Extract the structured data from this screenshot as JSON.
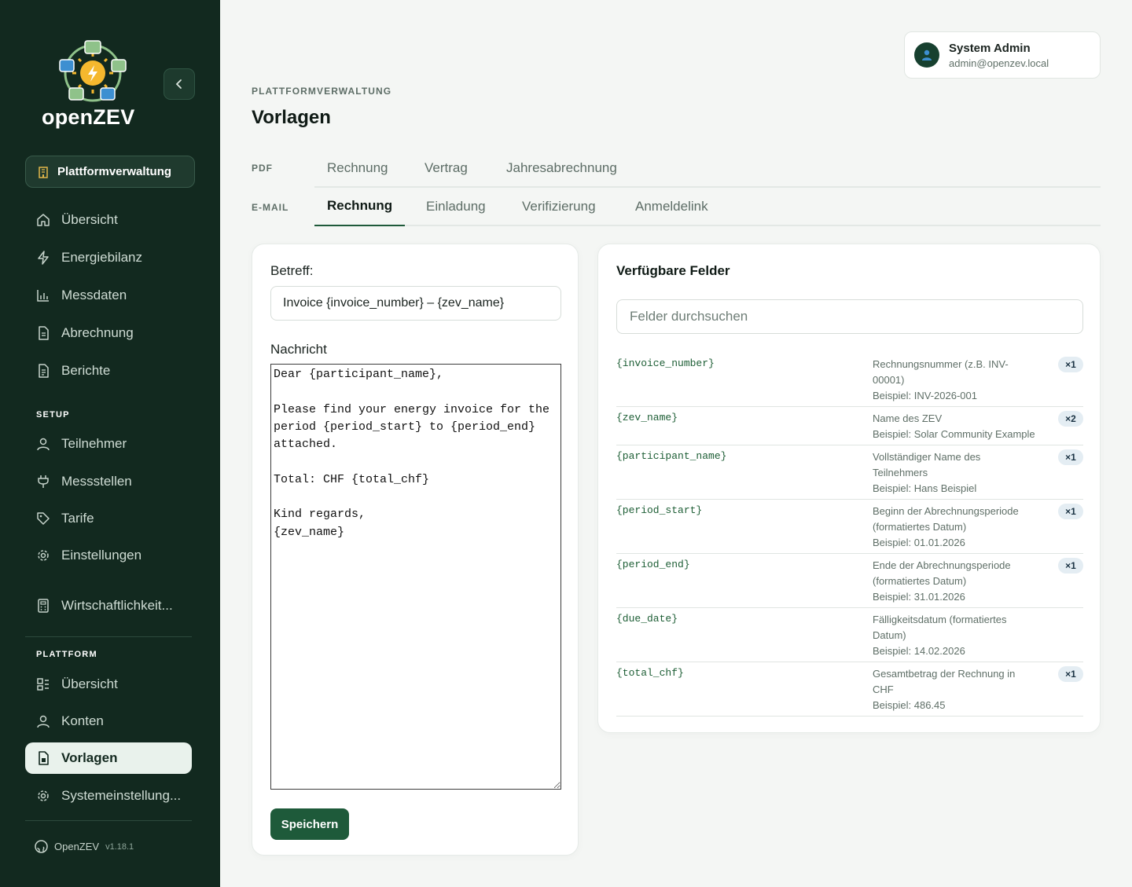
{
  "sidebar": {
    "logo_text": "openZEV",
    "platform_pill": "Plattformverwaltung",
    "main_items": [
      {
        "label": "Übersicht",
        "icon": "home-icon"
      },
      {
        "label": "Energiebilanz",
        "icon": "lightning-icon"
      },
      {
        "label": "Messdaten",
        "icon": "bar-chart-icon"
      },
      {
        "label": "Abrechnung",
        "icon": "document-icon"
      },
      {
        "label": "Berichte",
        "icon": "report-icon"
      }
    ],
    "setup_label": "SETUP",
    "setup_items": [
      {
        "label": "Teilnehmer",
        "icon": "user-icon"
      },
      {
        "label": "Messstellen",
        "icon": "plug-icon"
      },
      {
        "label": "Tarife",
        "icon": "tag-icon"
      },
      {
        "label": "Einstellungen",
        "icon": "gear-icon"
      },
      {
        "label": "Wirtschaftlichkeit...",
        "icon": "calculator-icon"
      }
    ],
    "platform_label": "PLATTFORM",
    "platform_items": [
      {
        "label": "Übersicht",
        "icon": "dashboard-icon"
      },
      {
        "label": "Konten",
        "icon": "users-icon"
      },
      {
        "label": "Vorlagen",
        "icon": "template-icon",
        "active": true
      },
      {
        "label": "Systemeinstellung...",
        "icon": "gear-icon"
      }
    ],
    "footer_name": "OpenZEV",
    "footer_version": "v1.18.1"
  },
  "user": {
    "name": "System Admin",
    "email": "admin@openzev.local"
  },
  "header": {
    "eyebrow": "PLATTFORMVERWALTUNG",
    "title": "Vorlagen"
  },
  "tabs": {
    "pdf_label": "PDF",
    "pdf_tabs": [
      "Rechnung",
      "Vertrag",
      "Jahresabrechnung"
    ],
    "email_label": "E-MAIL",
    "email_tabs": [
      "Rechnung",
      "Einladung",
      "Verifizierung",
      "Anmeldelink"
    ],
    "active_email_tab": "Rechnung"
  },
  "editor": {
    "subject_label": "Betreff:",
    "subject_value": "Invoice {invoice_number} – {zev_name}",
    "message_label": "Nachricht",
    "message_value": "Dear {participant_name},\n\nPlease find your energy invoice for the period {period_start} to {period_end} attached.\n\nTotal: CHF {total_chf}\n\nKind regards,\n{zev_name}",
    "save_label": "Speichern"
  },
  "fields_panel": {
    "title": "Verfügbare Felder",
    "search_placeholder": "Felder durchsuchen",
    "fields": [
      {
        "code": "{invoice_number}",
        "desc": "Rechnungsnummer (z.B. INV-00001)",
        "example": "Beispiel: INV-2026-001",
        "count": "×1"
      },
      {
        "code": "{zev_name}",
        "desc": "Name des ZEV",
        "example": "Beispiel: Solar Community Example",
        "count": "×2"
      },
      {
        "code": "{participant_name}",
        "desc": "Vollständiger Name des Teilnehmers",
        "example": "Beispiel: Hans Beispiel",
        "count": "×1"
      },
      {
        "code": "{period_start}",
        "desc": "Beginn der Abrechnungsperiode (formatiertes Datum)",
        "example": "Beispiel: 01.01.2026",
        "count": "×1"
      },
      {
        "code": "{period_end}",
        "desc": "Ende der Abrechnungsperiode (formatiertes Datum)",
        "example": "Beispiel: 31.01.2026",
        "count": "×1"
      },
      {
        "code": "{due_date}",
        "desc": "Fälligkeitsdatum (formatiertes Datum)",
        "example": "Beispiel: 14.02.2026",
        "count": ""
      },
      {
        "code": "{total_chf}",
        "desc": "Gesamtbetrag der Rechnung in CHF",
        "example": "Beispiel: 486.45",
        "count": "×1"
      }
    ]
  },
  "colors": {
    "sidebar_bg": "#12291f",
    "accent": "#1e5a3a",
    "page_bg": "#f4f6f4"
  }
}
